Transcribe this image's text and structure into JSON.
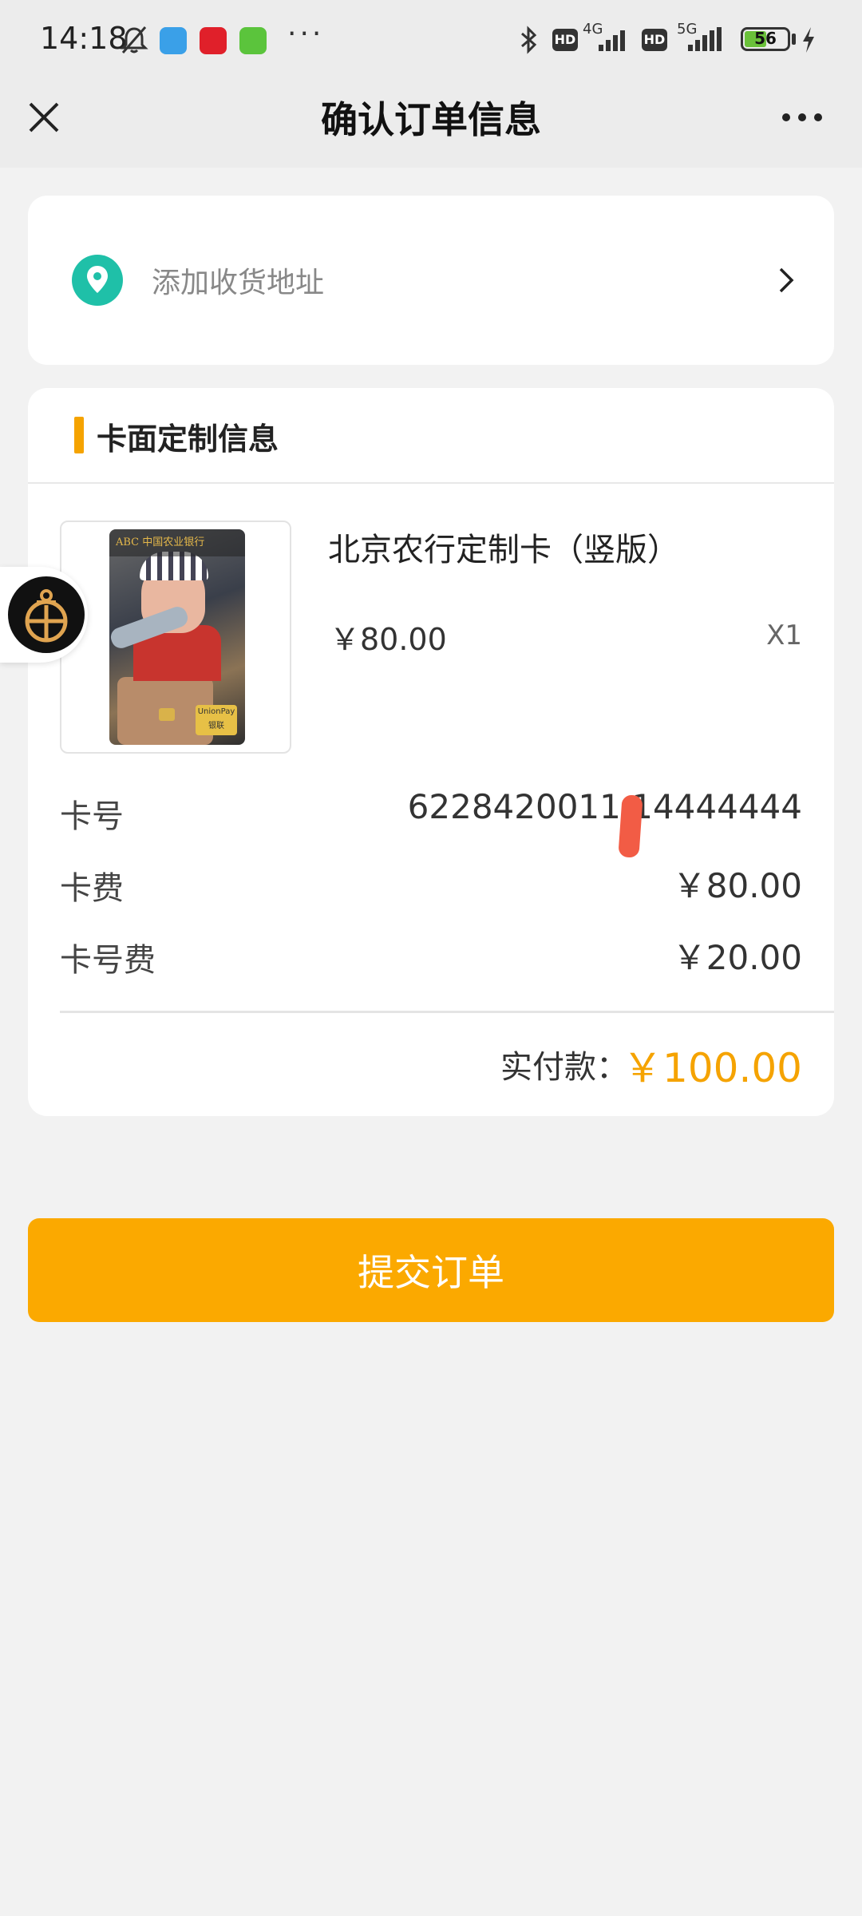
{
  "status_bar": {
    "time": "14:18",
    "network_1": "4G",
    "network_2": "5G",
    "hd_label": "HD",
    "battery_level": "56",
    "battery_percent": 56,
    "more_icon": "···"
  },
  "nav": {
    "title": "确认订单信息"
  },
  "address": {
    "placeholder_text": "添加收货地址"
  },
  "order": {
    "section_title": "卡面定制信息",
    "product": {
      "name": "北京农行定制卡（竖版）",
      "price": "￥80.00",
      "quantity": "X1",
      "card_top_text": "ABC 中国农业银行",
      "card_brand_text": "UnionPay 银联"
    },
    "rows": [
      {
        "label": "卡号",
        "value": "6228420011 14444444"
      },
      {
        "label": "卡费",
        "value": "￥80.00"
      },
      {
        "label": "卡号费",
        "value": "￥20.00"
      }
    ],
    "total_label": "实付款：",
    "total_value": "￥100.00"
  },
  "submit": {
    "label": "提交订单"
  },
  "colors": {
    "accent": "#fba900",
    "price_accent": "#f5a300",
    "pin": "#1fc0a8",
    "background": "#f2f2f2"
  },
  "icons": {
    "close": "close-icon",
    "more": "more-icon",
    "location": "location-pin-icon",
    "chevron": "chevron-right-icon",
    "floating": "floating-assistant-icon"
  }
}
